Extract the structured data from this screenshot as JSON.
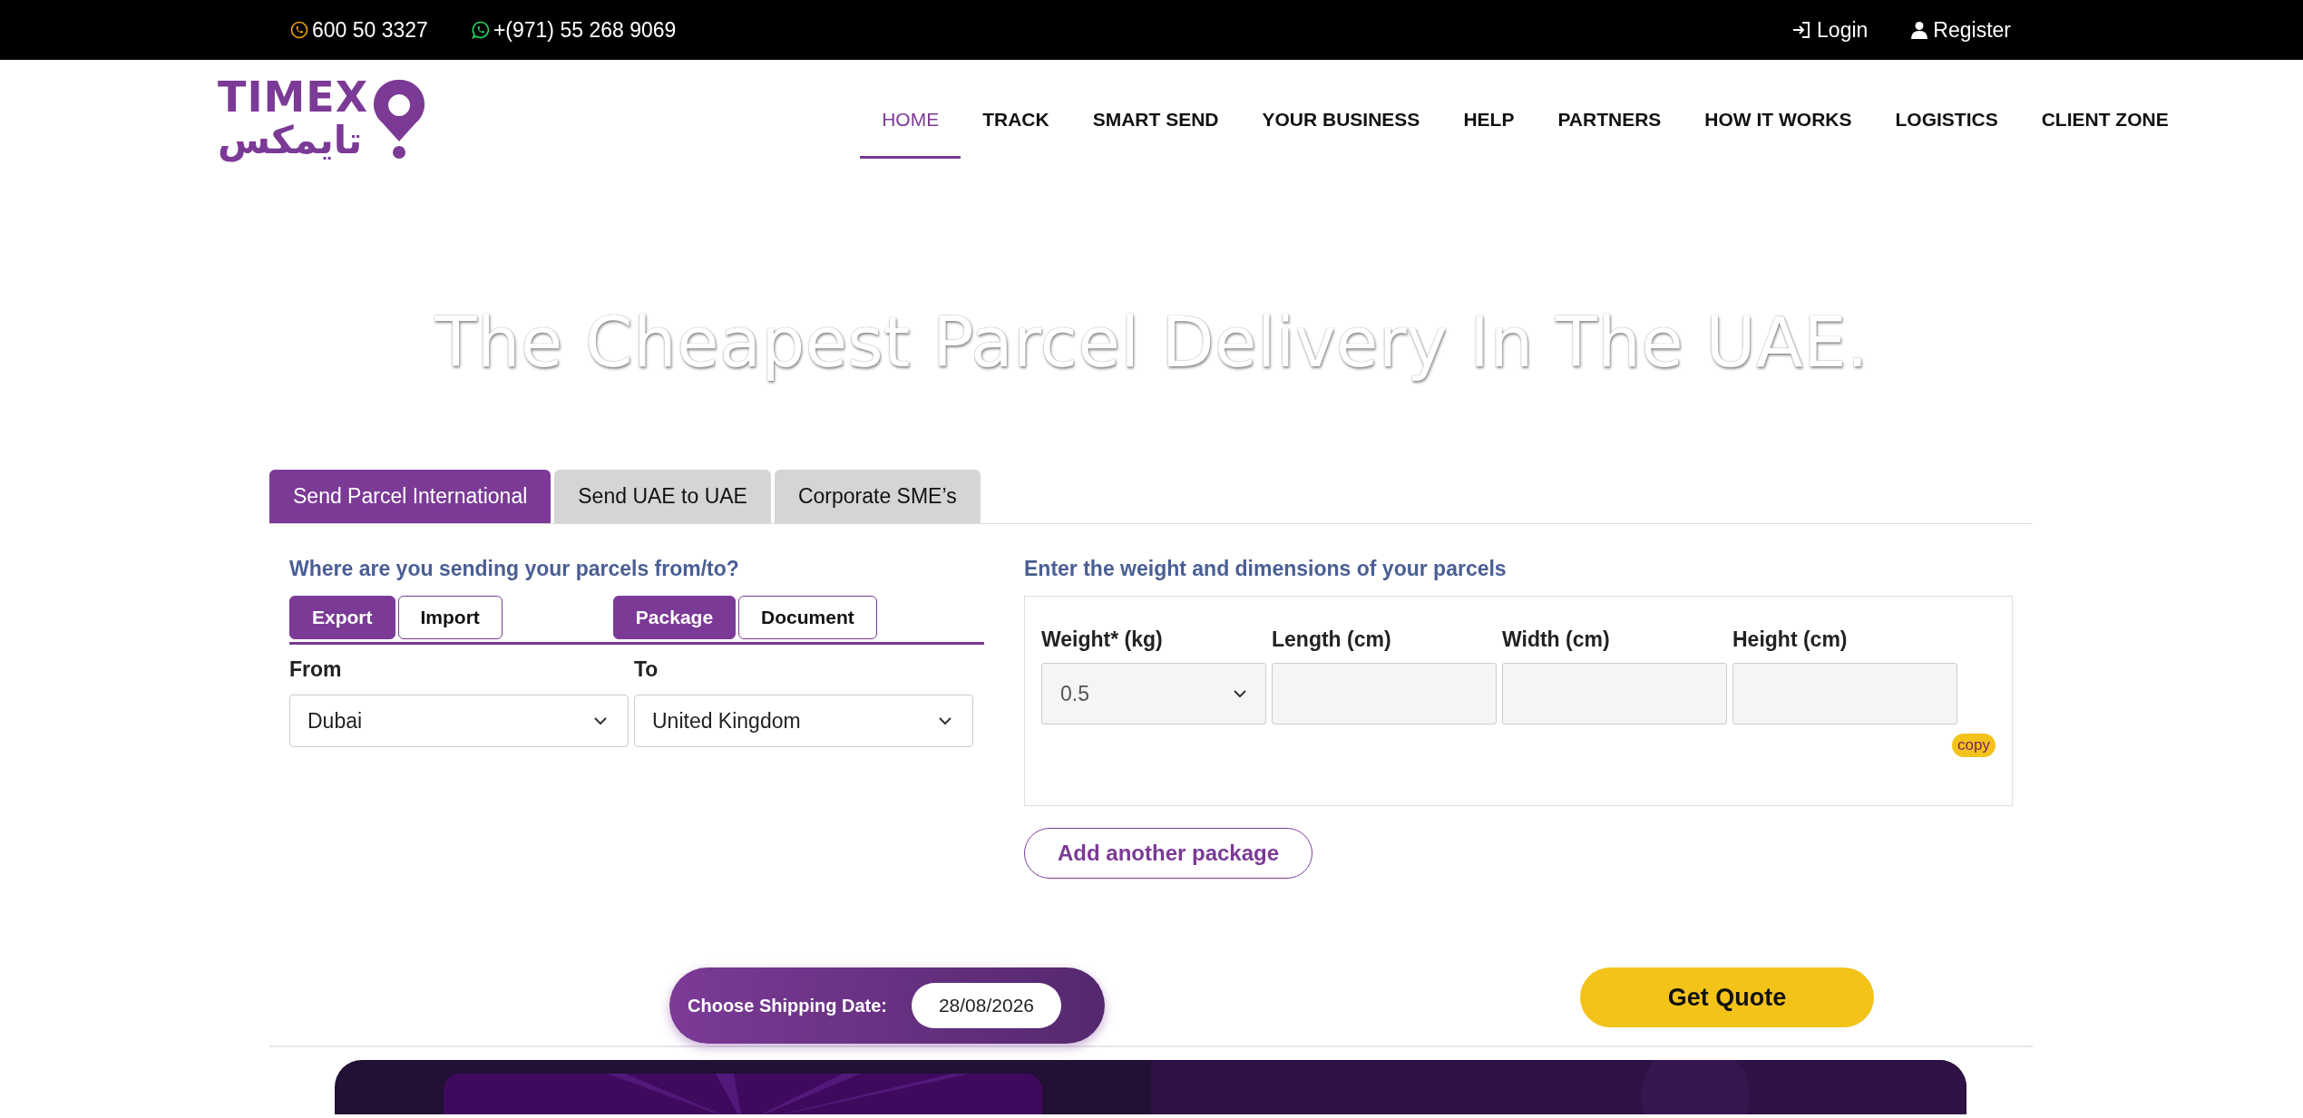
{
  "top_bar": {
    "contacts": [
      {
        "kind": "phone",
        "text": "600 50 3327"
      },
      {
        "kind": "whatsapp",
        "text": "+(971) 55 268 9069"
      }
    ],
    "account": [
      {
        "kind": "login",
        "text": "Login"
      },
      {
        "kind": "register",
        "text": "Register"
      }
    ]
  },
  "logo": {
    "text": "TIMEX",
    "arabic": "تايمكس"
  },
  "nav": [
    {
      "label": "HOME",
      "selected": true
    },
    {
      "label": "TRACK",
      "selected": false
    },
    {
      "label": "SMART SEND",
      "selected": false
    },
    {
      "label": "YOUR BUSINESS",
      "selected": false
    },
    {
      "label": "HELP",
      "selected": false
    },
    {
      "label": "PARTNERS",
      "selected": false
    },
    {
      "label": "HOW IT WORKS",
      "selected": false
    },
    {
      "label": "LOGISTICS",
      "selected": false
    },
    {
      "label": "CLIENT ZONE",
      "selected": false
    }
  ],
  "hero_title": "The Cheapest Parcel Delivery In The UAE.",
  "tabs": [
    {
      "label": "Send Parcel International",
      "selected": true
    },
    {
      "label": "Send UAE to UAE",
      "selected": false
    },
    {
      "label": "Corporate SME’s",
      "selected": false
    }
  ],
  "route": {
    "heading": "Where are you sending your parcels from/to?",
    "direction": [
      {
        "label": "Export",
        "selected": true
      },
      {
        "label": "Import",
        "selected": false
      }
    ],
    "type": [
      {
        "label": "Package",
        "selected": true
      },
      {
        "label": "Document",
        "selected": false
      }
    ],
    "fields": [
      {
        "label": "From",
        "value": "Dubai"
      },
      {
        "label": "To",
        "value": "United Kingdom"
      }
    ]
  },
  "parcel": {
    "heading": "Enter the weight and dimensions of your parcels",
    "fields": [
      {
        "kind": "select",
        "label": "Weight* (kg)",
        "value": "0.5"
      },
      {
        "kind": "input",
        "label": "Length (cm)"
      },
      {
        "kind": "input",
        "label": "Width (cm)"
      },
      {
        "kind": "input",
        "label": "Height (cm)"
      }
    ],
    "copy": "copy",
    "add_button": "Add another package"
  },
  "shipping_date": {
    "label": "Choose Shipping Date:",
    "value": "28/08/2026"
  },
  "quote_button": "Get Quote"
}
